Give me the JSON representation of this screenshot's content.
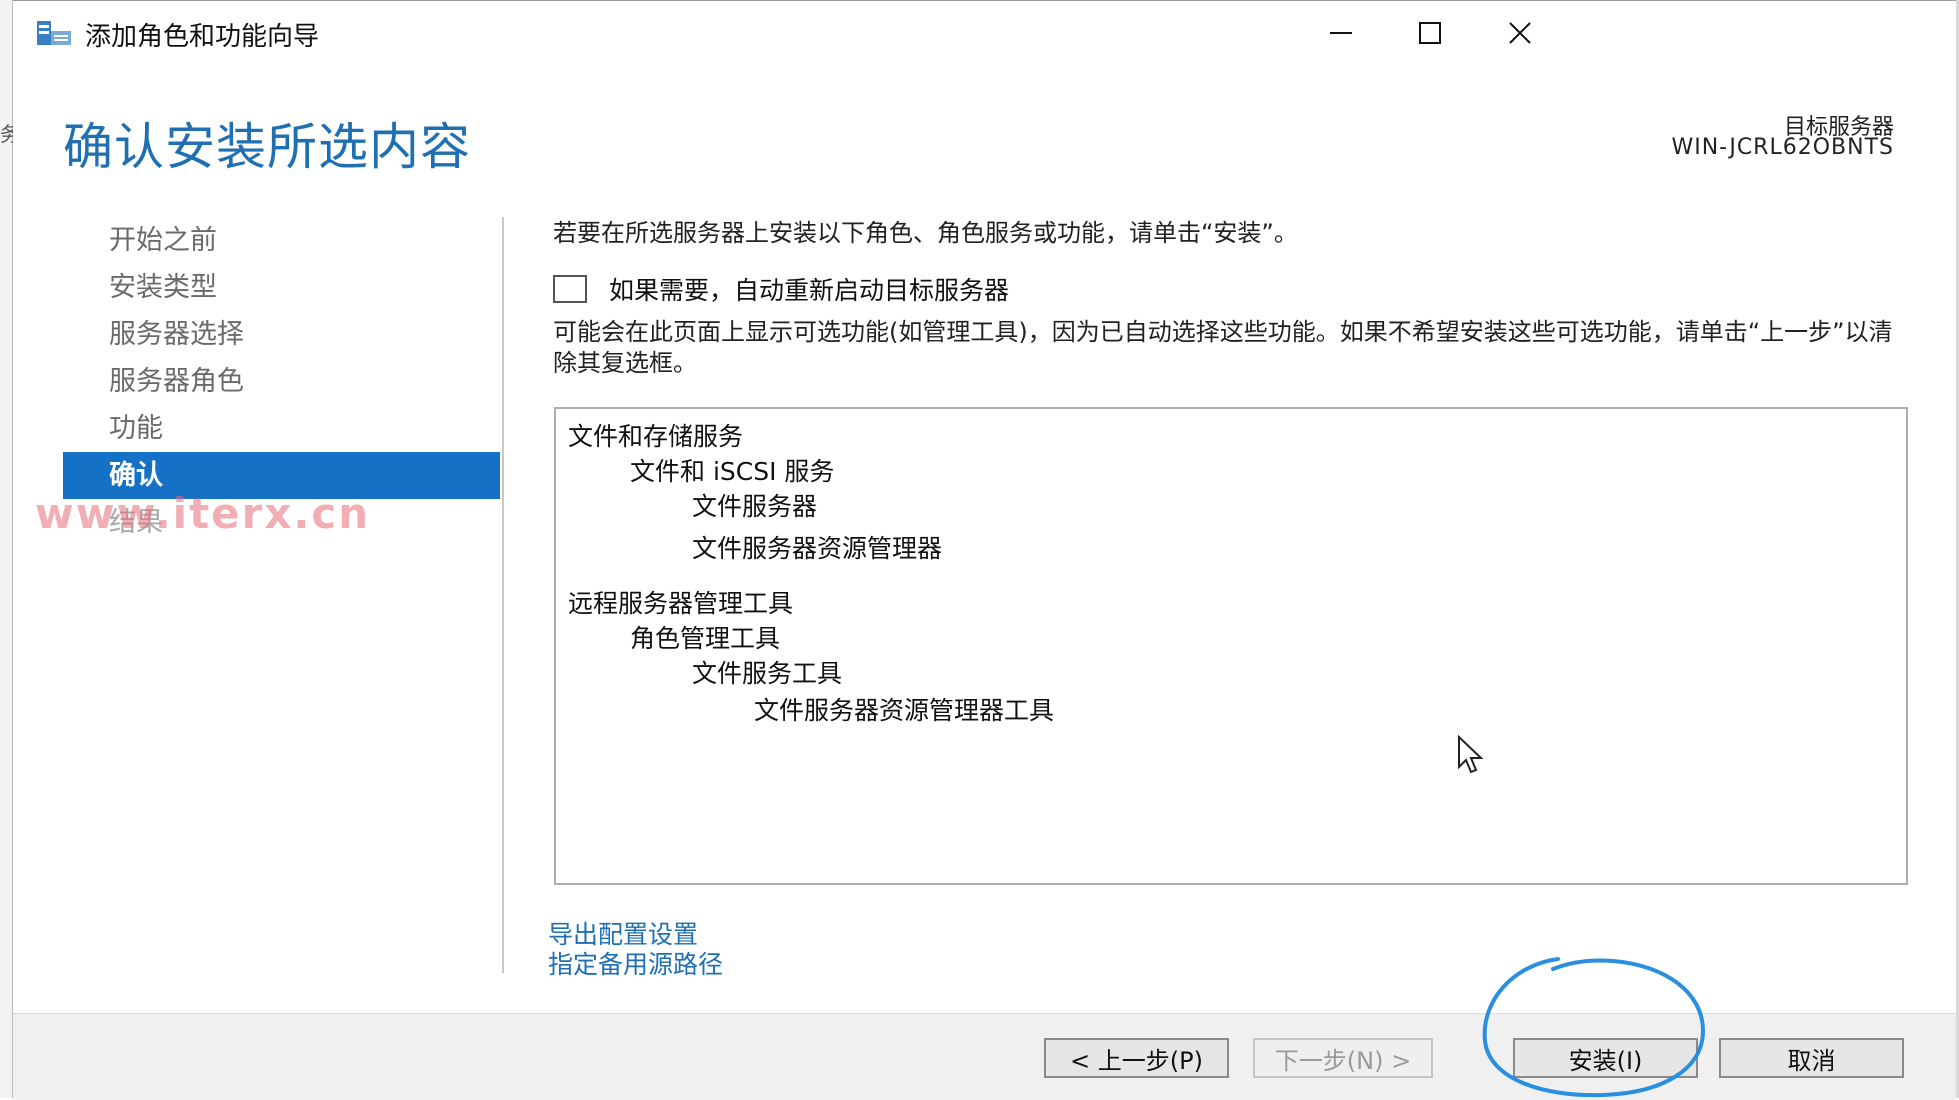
{
  "window": {
    "title": "添加角色和功能向导",
    "left_edge_glyph": "务"
  },
  "header": {
    "title": "确认安装所选内容",
    "target_label": "目标服务器",
    "target_server": "WIN-JCRL62OBNTS"
  },
  "nav": {
    "items": [
      {
        "label": "开始之前"
      },
      {
        "label": "安装类型"
      },
      {
        "label": "服务器选择"
      },
      {
        "label": "服务器角色"
      },
      {
        "label": "功能"
      },
      {
        "label": "确认"
      },
      {
        "label": "结果"
      }
    ],
    "active_index": 5
  },
  "content": {
    "intro": "若要在所选服务器上安装以下角色、角色服务或功能，请单击“安装”。",
    "restart_checkbox_label": "如果需要，自动重新启动目标服务器",
    "restart_checked": false,
    "note": "可能会在此页面上显示可选功能(如管理工具)，因为已自动选择这些功能。如果不希望安装这些可选功能，请单击“上一步”以清除其复选框。"
  },
  "features": [
    {
      "label": "文件和存储服务",
      "level": 0
    },
    {
      "label": "文件和 iSCSI 服务",
      "level": 1
    },
    {
      "label": "文件服务器",
      "level": 2
    },
    {
      "label": "文件服务器资源管理器",
      "level": 2
    },
    {
      "label": "远程服务器管理工具",
      "level": 0
    },
    {
      "label": "角色管理工具",
      "level": 1
    },
    {
      "label": "文件服务工具",
      "level": 2
    },
    {
      "label": "文件服务器资源管理器工具",
      "level": 3
    }
  ],
  "links": {
    "export": "导出配置设置",
    "alternate_source": "指定备用源路径"
  },
  "buttons": {
    "previous": "< 上一步(P)",
    "next": "下一步(N) >",
    "install": "安装(I)",
    "cancel": "取消"
  },
  "watermark": "www.iterx.cn",
  "colors": {
    "accent": "#1f6fb2",
    "nav_active_bg": "#1571c6",
    "annotation_circle": "#2a8fe0"
  }
}
